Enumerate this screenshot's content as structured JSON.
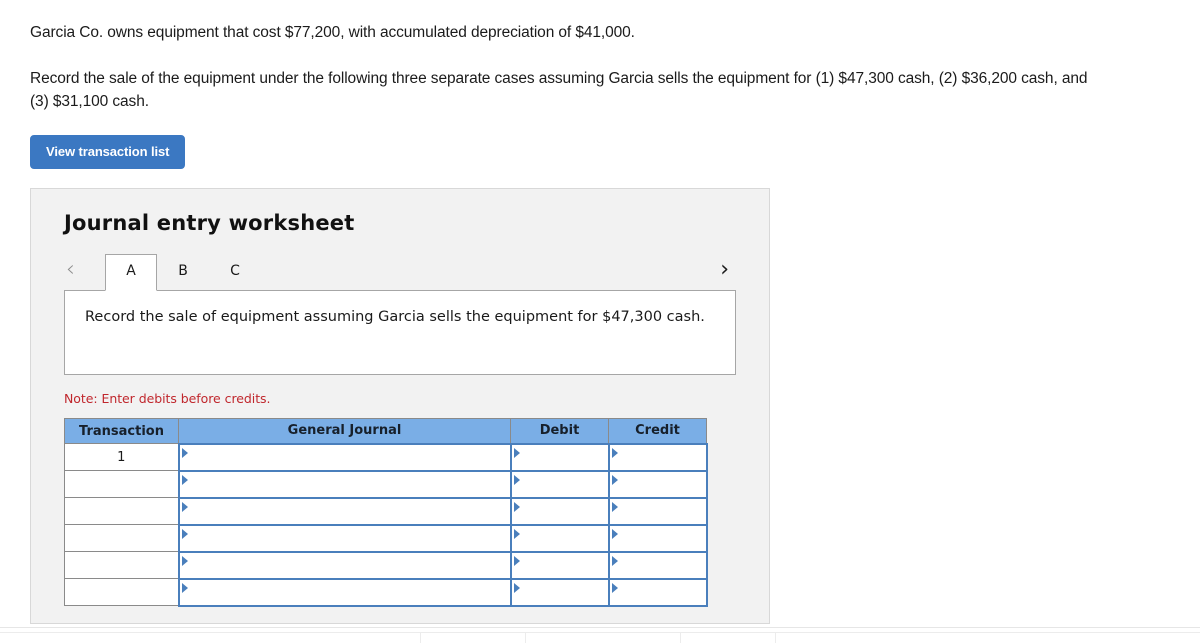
{
  "problem": {
    "line1": "Garcia Co. owns equipment that cost $77,200, with accumulated depreciation of $41,000.",
    "line2": "Record the sale of the equipment under the following three separate cases assuming Garcia sells the equipment for (1) $47,300 cash, (2) $36,200 cash, and (3) $31,100 cash."
  },
  "toolbar": {
    "view_transaction_list_label": "View transaction list"
  },
  "worksheet": {
    "title": "Journal entry worksheet",
    "nav": {
      "prev_icon": "chevron-left-icon",
      "next_icon": "chevron-right-icon",
      "prev_glyph": "‹",
      "next_glyph": "›"
    },
    "tabs": [
      {
        "label": "A",
        "active": true
      },
      {
        "label": "B",
        "active": false
      },
      {
        "label": "C",
        "active": false
      }
    ],
    "instruction": "Record the sale of equipment assuming Garcia sells the equipment for $47,300 cash.",
    "note": "Note: Enter debits before credits.",
    "table": {
      "headers": [
        "Transaction",
        "General Journal",
        "Debit",
        "Credit"
      ],
      "rows": [
        {
          "transaction": "1",
          "general_journal": "",
          "debit": "",
          "credit": ""
        },
        {
          "transaction": "",
          "general_journal": "",
          "debit": "",
          "credit": ""
        },
        {
          "transaction": "",
          "general_journal": "",
          "debit": "",
          "credit": ""
        },
        {
          "transaction": "",
          "general_journal": "",
          "debit": "",
          "credit": ""
        },
        {
          "transaction": "",
          "general_journal": "",
          "debit": "",
          "credit": ""
        },
        {
          "transaction": "",
          "general_journal": "",
          "debit": "",
          "credit": ""
        }
      ]
    }
  },
  "colors": {
    "button_blue": "#3b78c2",
    "table_header_blue": "#7aaee6",
    "input_border_blue": "#4a7fbc",
    "note_red": "#c0272d",
    "panel_gray": "#f2f2f2"
  }
}
